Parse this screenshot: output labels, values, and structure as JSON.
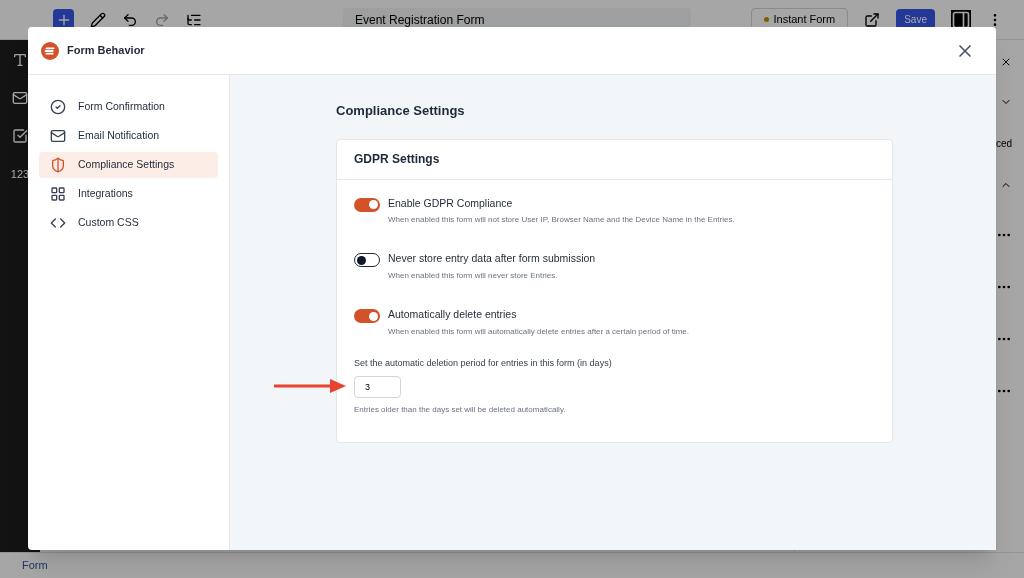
{
  "editor": {
    "document_title": "Event Registration Form",
    "status_button": "Instant Form",
    "save_button": "Save",
    "left_rail_text": "123",
    "right_panel_texts": [
      "ced"
    ],
    "footer_breadcrumb": "Form"
  },
  "modal": {
    "title": "Form Behavior",
    "nav": [
      {
        "label": "Form Confirmation",
        "kind": "check",
        "selected": false
      },
      {
        "label": "Email Notification",
        "kind": "mail",
        "selected": false
      },
      {
        "label": "Compliance Settings",
        "kind": "shield",
        "selected": true
      },
      {
        "label": "Integrations",
        "kind": "grid",
        "selected": false
      },
      {
        "label": "Custom CSS",
        "kind": "code",
        "selected": false
      }
    ],
    "heading": "Compliance Settings",
    "card": {
      "title": "GDPR Settings",
      "toggles": [
        {
          "label": "Enable GDPR Compliance",
          "help": "When enabled this form will not store User IP, Browser Name and the Device Name in the Entries.",
          "on": true
        },
        {
          "label": "Never store entry data after form submission",
          "help": "When enabled this form will never store Entries.",
          "on": false
        },
        {
          "label": "Automatically delete entries",
          "help": "When enabled this form will automatically delete entries after a certain period of time.",
          "on": true
        }
      ],
      "period_label": "Set the automatic deletion period for entries in this form (in days)",
      "period_value": "3",
      "period_help": "Entries older than the days set will be deleted automatically."
    }
  }
}
